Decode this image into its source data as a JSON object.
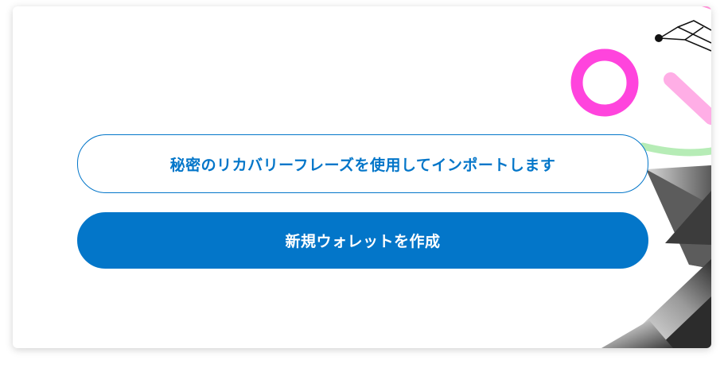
{
  "buttons": {
    "import_label": "秘密のリカバリーフレーズを使用してインポートします",
    "create_label": "新規ウォレットを作成"
  },
  "colors": {
    "accent": "#0376c9",
    "ring": "#ff44dd",
    "pink_bar": "#ffaee6",
    "green_arc": "#b6ecb6"
  },
  "icons": {
    "ring": "decorative-ring-icon",
    "bar": "decorative-bar-icon",
    "shapes": "decorative-geometric-shapes"
  }
}
